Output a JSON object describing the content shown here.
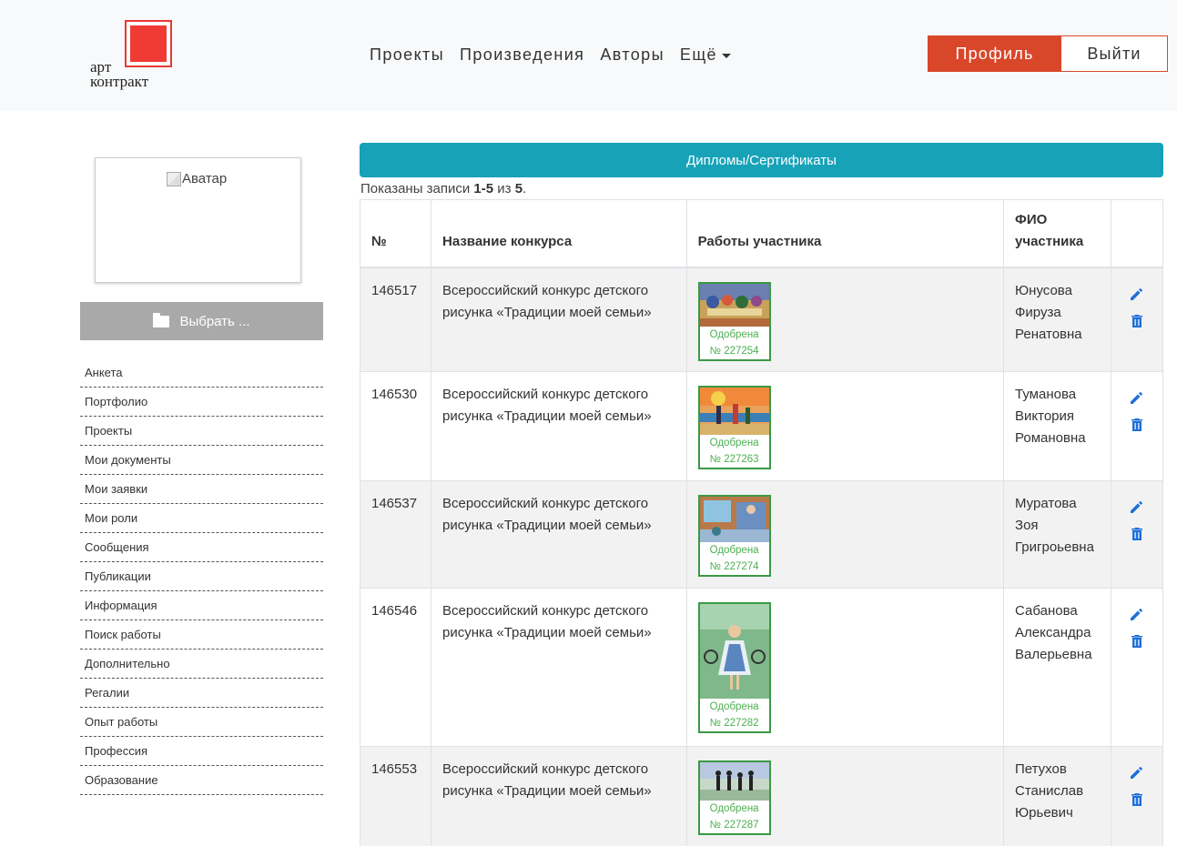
{
  "logo": {
    "line1": "арт",
    "line2": "контракт"
  },
  "nav": {
    "items": [
      "Проекты",
      "Произведения",
      "Авторы",
      "Ещё"
    ]
  },
  "header": {
    "profile_label": "Профиль",
    "logout_label": "Выйти"
  },
  "sidebar": {
    "avatar_alt": "Аватар",
    "choose_label": "Выбрать ...",
    "menu": [
      "Анкета",
      "Портфолио",
      "Проекты",
      "Мои документы",
      "Мои заявки",
      "Мои роли",
      "Сообщения",
      "Публикации",
      "Информация",
      "Поиск работы",
      "Дополнительно",
      "Регалии",
      "Опыт работы",
      "Профессия",
      "Образование"
    ]
  },
  "main": {
    "diplomas_label": "Дипломы/Сертификаты",
    "summary_prefix": "Показаны записи ",
    "summary_range": "1-5",
    "summary_mid": " из ",
    "summary_total": "5",
    "summary_suffix": ".",
    "columns": [
      "№",
      "Название конкурса",
      "Работы участника",
      "ФИО участника",
      ""
    ],
    "rows": [
      {
        "id": "146517",
        "contest_line1": "Всероссийский конкурс детского",
        "contest_line2": "рисунка «Традиции моей семьи»",
        "status": "Одобрена",
        "work_no": "№ 227254",
        "fio1": "Юнусова",
        "fio2": "Фируза",
        "fio3": "Ренатовна"
      },
      {
        "id": "146530",
        "contest_line1": "Всероссийский конкурс детского",
        "contest_line2": "рисунка «Традиции моей семьи»",
        "status": "Одобрена",
        "work_no": "№ 227263",
        "fio1": "Туманова",
        "fio2": "Виктория",
        "fio3": "Романовна"
      },
      {
        "id": "146537",
        "contest_line1": "Всероссийский конкурс детского",
        "contest_line2": "рисунка «Традиции моей семьи»",
        "status": "Одобрена",
        "work_no": "№ 227274",
        "fio1": "Муратова",
        "fio2": "Зоя",
        "fio3": "Григроьевна"
      },
      {
        "id": "146546",
        "contest_line1": "Всероссийский конкурс детского",
        "contest_line2": "рисунка «Традиции моей семьи»",
        "status": "Одобрена",
        "work_no": "№ 227282",
        "fio1": "Сабанова",
        "fio2": "Александра",
        "fio3": "Валерьевна"
      },
      {
        "id": "146553",
        "contest_line1": "Всероссийский конкурс детского",
        "contest_line2": "рисунка «Традиции моей семьи»",
        "status": "Одобрена",
        "work_no": "№ 227287",
        "fio1": "Петухов",
        "fio2": "Станислав",
        "fio3": "Юрьевич"
      }
    ]
  },
  "colors": {
    "accent": "#d9472b",
    "teal": "#17a2b8",
    "approved": "#4caf50",
    "icon_blue": "#1e6fd9"
  },
  "icons": {
    "edit": "pencil-icon",
    "delete": "trash-icon",
    "folder": "folder-icon"
  }
}
